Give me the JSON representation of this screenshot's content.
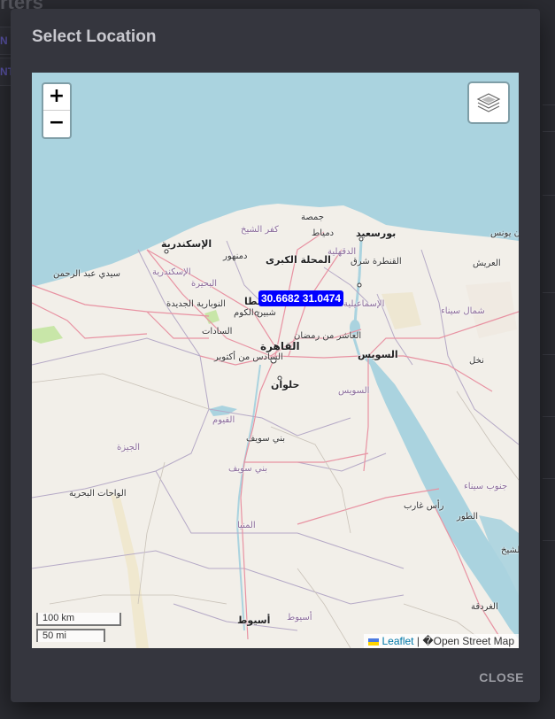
{
  "background": {
    "title_fragment": "rters",
    "tab_fragment_1": "N",
    "tab_fragment_2": "NT"
  },
  "modal": {
    "title": "Select Location",
    "close_label": "CLOSE"
  },
  "map": {
    "zoom_in": "+",
    "zoom_out": "−",
    "marker_label": "30.6682 31.0474",
    "scale": {
      "km": "100 km",
      "mi": "50 mi"
    },
    "attribution": {
      "leaflet": "Leaflet",
      "separator": " | ",
      "osm": "�Open Street Map"
    },
    "colors": {
      "sea": "#aad3df",
      "land": "#f2efe9",
      "marker": "#0000ff",
      "major_road": "#e892a2"
    },
    "places": {
      "alexandria": "الإسكندرية",
      "alexandria_gov": "الإسكندرية",
      "kafr_sheikh": "كفر الشيخ",
      "damietta_city": "دمياط",
      "gomsa": "جمصة",
      "port_said": "بورسعيد",
      "el_arish_city": "العريش",
      "khan_younis": "خان يونس",
      "damanhour": "دمنهور",
      "mahalla": "المحلة الكبرى",
      "dakahlia": "الدقهلية",
      "qantara": "القنطرة شرق",
      "sidi_abdel_rahman": "سيدي عبد الرحمن",
      "beheira": "البحيرة",
      "tanta": "طنطا",
      "ismailia": "الإسماعيلية",
      "north_sinai": "شمال سيناء",
      "nubaria": "النوبارية الجديدة",
      "shibin": "شبين الكوم",
      "sadat": "السادات",
      "tenth_ramadan": "العاشر من رمضان",
      "cairo": "القاهرة",
      "october": "السادس من أكتوبر",
      "suez": "السويس",
      "suez_gov": "السويس",
      "nakhl": "نخل",
      "helwan": "حلوان",
      "faiyum": "الفيوم",
      "beni_suef": "بني سويف",
      "beni_suef_gov": "بني سويف",
      "giza": "الجيزة",
      "south_sinai": "جنوب سيناء",
      "bahariya": "الواحات البحرية",
      "ras_gharib": "رأس غارب",
      "tor": "الطور",
      "sharm": "شرم الشيخ",
      "minya": "المنيا",
      "hurghada": "الغردقة",
      "asyut": "أسيوط",
      "asyut_gov": "أسيوط"
    }
  }
}
